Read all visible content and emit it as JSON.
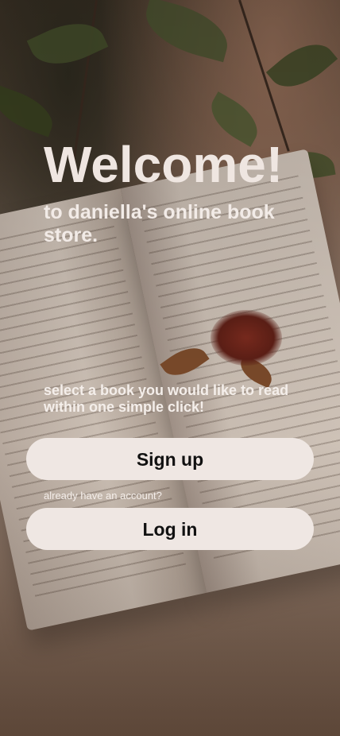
{
  "welcome": {
    "title": "Welcome!",
    "subtitle": "to daniella's online book store.",
    "tagline": "select a book you would like to read within one simple click!"
  },
  "actions": {
    "signup_label": "Sign up",
    "account_hint": "already have an account?",
    "login_label": "Log in"
  },
  "colors": {
    "button_bg": "#efe7e3",
    "button_text": "#111111",
    "heading_text": "#efe6e1"
  }
}
